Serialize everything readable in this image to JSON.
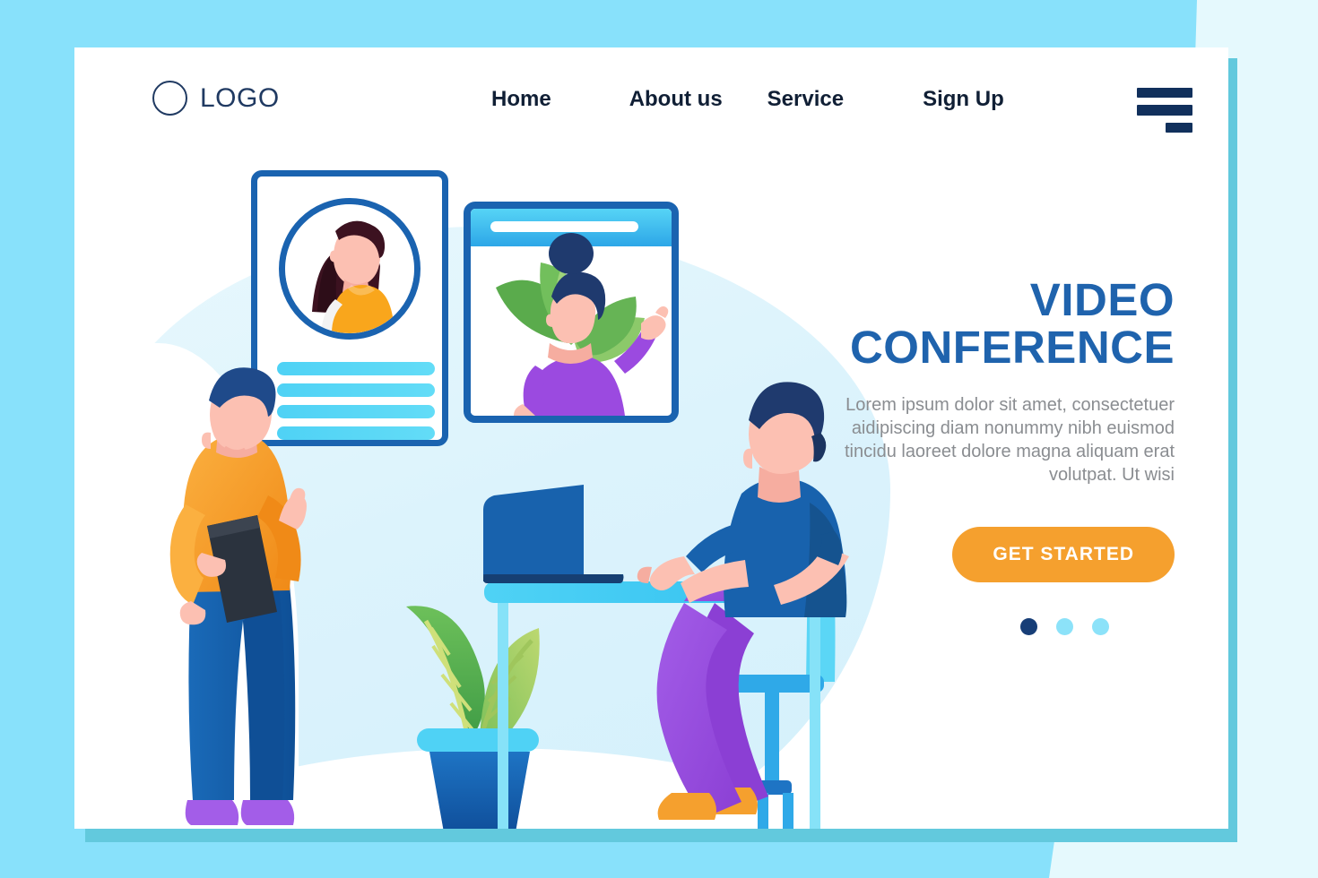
{
  "page": {
    "background_color": "#88e1fb",
    "card_background": "#ffffff",
    "card_shadow_color": "#62c9dd"
  },
  "header": {
    "logo": {
      "icon": "circle-outline-icon",
      "text": "LOGO",
      "color": "#203a62"
    },
    "nav_items": [
      {
        "label": "Home"
      },
      {
        "label": "About us"
      },
      {
        "label": "Service"
      },
      {
        "label": "Sign Up"
      }
    ],
    "menu_icon": "hamburger-menu-icon"
  },
  "hero": {
    "title_line1": "VIDEO",
    "title_line2": "CONFERENCE",
    "title_color": "#1f63ad",
    "paragraph": "Lorem ipsum dolor sit amet, consectetuer aidipiscing diam nonummy nibh euismod tincidu laoreet dolore magna aliquam erat volutpat. Ut wisi",
    "paragraph_color": "#8a8d91",
    "cta_label": "GET STARTED",
    "cta_color": "#f5a02e",
    "carousel": {
      "total": 3,
      "active_index": 0,
      "active_color": "#173e77",
      "inactive_color": "#8ce2f9"
    }
  },
  "illustration": {
    "profile_card": {
      "name": "profile-card",
      "border_color": "#1a63b0",
      "avatar": {
        "hair_color": "#3c1220",
        "shirt_color": "#f9a61c",
        "skin_color": "#fcc0b2"
      },
      "placeholder_bars": 4,
      "bar_color": "#4fd2f5"
    },
    "video_window": {
      "name": "video-call-window",
      "border_color": "#1a63b0",
      "titlebar_color": "#2fa9e8",
      "person": {
        "hair_color": "#1f3a6e",
        "shirt_color": "#9b4ae0",
        "skin_color": "#fcc0b2",
        "gesture": "waving"
      },
      "foliage_color": "#5aab4c"
    },
    "standing_man": {
      "name": "standing-man-with-tablet",
      "hair_color": "#1f4a8a",
      "sweater_color": "#f9a61c",
      "pants_color": "#1860ab",
      "shoes_color": "#a35de8",
      "tablet_color": "#2b333e"
    },
    "seated_man": {
      "name": "seated-man-at-laptop",
      "hair_color": "#1f3a6e",
      "shirt_color": "#1862ad",
      "pants_color": "#9b4ae0",
      "shoes_color": "#f5a02e"
    },
    "laptop": {
      "name": "laptop",
      "color": "#1862ad"
    },
    "desk": {
      "name": "desk",
      "color": "#4fd2f5"
    },
    "chair": {
      "name": "office-chair",
      "color": "#4fd2f5"
    },
    "plant": {
      "name": "potted-plant",
      "leaf_color": "#4caf50",
      "pot_color": "#1862ad",
      "rim_color": "#4fd2f5"
    }
  }
}
